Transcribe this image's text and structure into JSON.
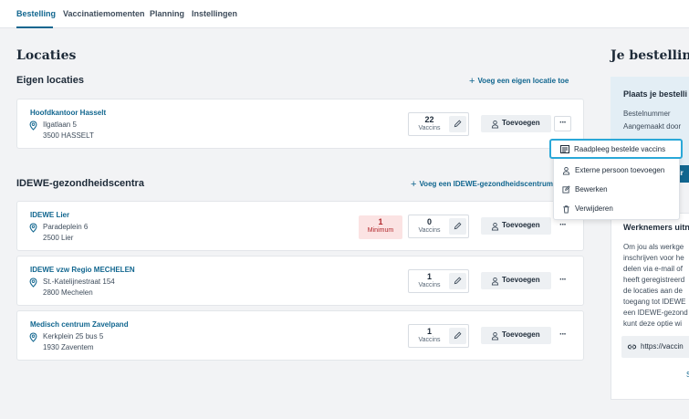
{
  "nav": {
    "tabs": [
      {
        "label": "Bestelling"
      },
      {
        "label": "Vaccinatiemomenten"
      },
      {
        "label": "Planning"
      },
      {
        "label": "Instellingen"
      }
    ]
  },
  "main": {
    "title": "Locaties",
    "own_section": {
      "title": "Eigen locaties",
      "add_link": "Voeg een eigen locatie toe",
      "locations": [
        {
          "name": "Hoofdkantoor Hasselt",
          "street": "Ilgatlaan 5",
          "city": "3500 HASSELT",
          "vaccins_count": "22",
          "vaccins_label": "Vaccins",
          "add_label": "Toevoegen"
        }
      ]
    },
    "idewe_section": {
      "title": "IDEWE-gezondheidscentra",
      "add_link": "Voeg een IDEWE-gezondheidscentrum toe",
      "locations": [
        {
          "name": "IDEWE Lier",
          "street": "Paradeplein 6",
          "city": "2500 Lier",
          "minimum_count": "1",
          "minimum_label": "Minimum",
          "vaccins_count": "0",
          "vaccins_label": "Vaccins",
          "add_label": "Toevoegen"
        },
        {
          "name": "IDEWE vzw Regio MECHELEN",
          "street": "St.-Katelijnestraat 154",
          "city": "2800 Mechelen",
          "vaccins_count": "1",
          "vaccins_label": "Vaccins",
          "add_label": "Toevoegen"
        },
        {
          "name": "Medisch centrum Zavelpand",
          "street": "Kerkplein 25 bus 5",
          "city": "1930 Zaventem",
          "vaccins_count": "1",
          "vaccins_label": "Vaccins",
          "add_label": "Toevoegen"
        }
      ]
    }
  },
  "context_menu": {
    "items": [
      {
        "label": "Raadpleeg bestelde vaccins",
        "icon": "list-icon"
      },
      {
        "label": "Externe persoon toevoegen",
        "icon": "person-icon"
      },
      {
        "label": "Bewerken",
        "icon": "edit-icon"
      },
      {
        "label": "Verwijderen",
        "icon": "trash-icon"
      }
    ]
  },
  "sidebar": {
    "title": "Je bestelling",
    "order_card": {
      "title": "Plaats je bestelli",
      "line1": "Bestelnummer",
      "line2": "Aangemaakt door",
      "button": "cir"
    },
    "workers_card": {
      "title": "Werknemers uitn",
      "lines": [
        "Om jou als werkge",
        "inschrijven voor he",
        "delen via e-mail of",
        "heeft geregistreerd",
        "de locaties aan de",
        "toegang tot IDEWE",
        "een IDEWE-gezond",
        "kunt deze optie wi"
      ],
      "url": "https://vaccin",
      "trailing": "S"
    }
  },
  "colors": {
    "accent": "#11668f",
    "minimum_bg": "#fbe3e3",
    "minimum_text": "#b1272b",
    "highlight": "#2aa8d8"
  }
}
